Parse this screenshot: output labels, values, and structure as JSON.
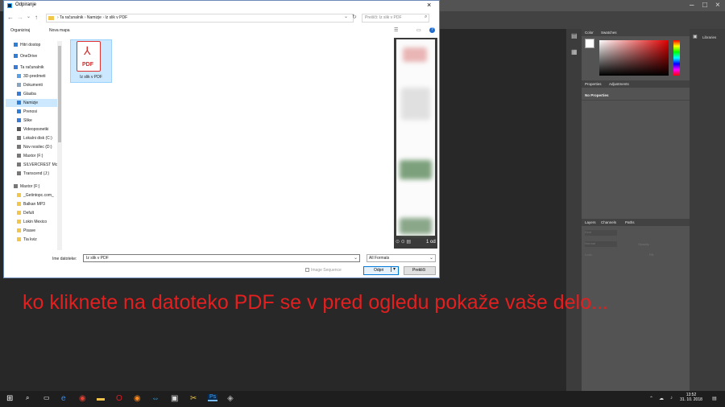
{
  "dialog": {
    "title": "Odpiranje",
    "breadcrumb": [
      "Ta računalnik",
      "Namizje",
      "Iz slik v PDF"
    ],
    "search_placeholder": "Preišči: Iz slik v PDF",
    "toolbar": {
      "organize": "Organiziraj",
      "new_folder": "Nova mapa"
    },
    "nav_items": [
      {
        "label": "Hitri dostop",
        "icon": "star-icon"
      },
      {
        "label": "OneDrive",
        "icon": "cloud-icon"
      },
      {
        "label": "Ta računalnik",
        "icon": "computer-icon"
      },
      {
        "label": "3D-predmeti",
        "icon": "cube-icon"
      },
      {
        "label": "Dokumenti",
        "icon": "document-icon"
      },
      {
        "label": "Glasba",
        "icon": "music-icon"
      },
      {
        "label": "Namizje",
        "icon": "desktop-icon",
        "selected": true
      },
      {
        "label": "Prenosi",
        "icon": "download-icon"
      },
      {
        "label": "Slike",
        "icon": "picture-icon"
      },
      {
        "label": "Videoposnetki",
        "icon": "video-icon"
      },
      {
        "label": "Lokalni disk (C:)",
        "icon": "drive-icon"
      },
      {
        "label": "Nov nosilec (D:)",
        "icon": "drive-icon"
      },
      {
        "label": "Maxtor (F:)",
        "icon": "drive-icon"
      },
      {
        "label": "SILVERCREST Mc",
        "icon": "drive-icon"
      },
      {
        "label": "Transcend (J:)",
        "icon": "drive-icon"
      },
      {
        "label": "Maxtor (F:)",
        "icon": "drive-icon"
      },
      {
        "label": "_Getintopc.com_",
        "icon": "folder-icon"
      },
      {
        "label": "Balkan MP3",
        "icon": "folder-icon"
      },
      {
        "label": "Defult",
        "icon": "folder-icon"
      },
      {
        "label": "Lokin Mexico",
        "icon": "folder-icon"
      },
      {
        "label": "Pisave",
        "icon": "folder-icon"
      },
      {
        "label": "Tia kviz",
        "icon": "folder-icon"
      }
    ],
    "file": {
      "name": "Iz slik v PDF",
      "icon_text": "PDF"
    },
    "preview_count": "1 od",
    "filename_label": "Ime datoteke:",
    "filename_value": "Iz slik v PDF",
    "filter_value": "All Formats",
    "image_sequence_label": "Image Sequence",
    "open_button": "Odpri",
    "cancel_button": "Prekliči"
  },
  "photoshop": {
    "color_tabs": [
      "Color",
      "Swatches"
    ],
    "properties_tabs": [
      "Properties",
      "Adjustments"
    ],
    "no_properties": "No Properties",
    "layers_tabs": [
      "Layers",
      "Channels",
      "Paths"
    ],
    "libraries_label": "Libraries",
    "layers_filter": "Kind",
    "blend_mode": "Normal",
    "opacity_label": "Opacity:",
    "lock_label": "Lock:",
    "fill_label": "Fill:"
  },
  "annotation": "ko kliknete na datoteko PDF se v pred ogledu pokaže vaše delo...",
  "taskbar": {
    "time": "13:52",
    "date": "31. 10. 2018"
  },
  "colors": {
    "annotation": "#e41f1f",
    "selection": "#cce8ff",
    "ps_panel": "#535353"
  }
}
